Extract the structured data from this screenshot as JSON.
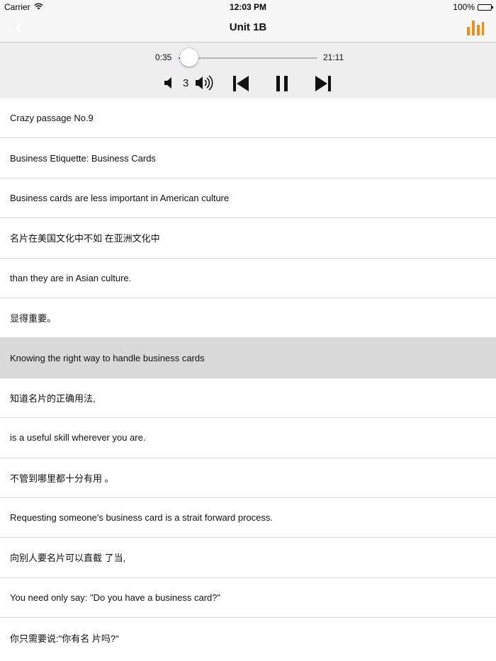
{
  "status_bar": {
    "carrier": "Carrier",
    "time": "12:03 PM",
    "battery": "100%"
  },
  "nav": {
    "title": "Unit 1B",
    "back_icon": "chevron-left-icon",
    "stats_icon": "bar-chart-icon",
    "accent_color": "#f08c1a"
  },
  "player": {
    "current_time": "0:35",
    "total_time": "21:11",
    "progress": 0.0276,
    "volume_level": "3",
    "tint_color": "#1a7ee8"
  },
  "lines": [
    {
      "text": "Crazy passage No.9",
      "active": false
    },
    {
      "text": "Business Etiquette: Business Cards",
      "active": false
    },
    {
      "text": "Business cards are less important in American culture",
      "active": false
    },
    {
      "text": "名片在美国文化中不如 在亚洲文化中",
      "active": false
    },
    {
      "text": "than they are in Asian culture.",
      "active": false
    },
    {
      "text": "显得重要。",
      "active": false
    },
    {
      "text": "Knowing the right way to handle business cards",
      "active": true
    },
    {
      "text": "知道名片的正确用法,",
      "active": false
    },
    {
      "text": "is a useful skill wherever you are.",
      "active": false
    },
    {
      "text": "不管到哪里都十分有用 。",
      "active": false
    },
    {
      "text": "Requesting someone's business card is a strait forward process.",
      "active": false
    },
    {
      "text": "向别人要名片可以直截 了当,",
      "active": false
    },
    {
      "text": "You need only say: \"Do you have a business card?\"",
      "active": false
    },
    {
      "text": "你只需要说:\"你有名 片吗?\"",
      "active": false
    }
  ]
}
